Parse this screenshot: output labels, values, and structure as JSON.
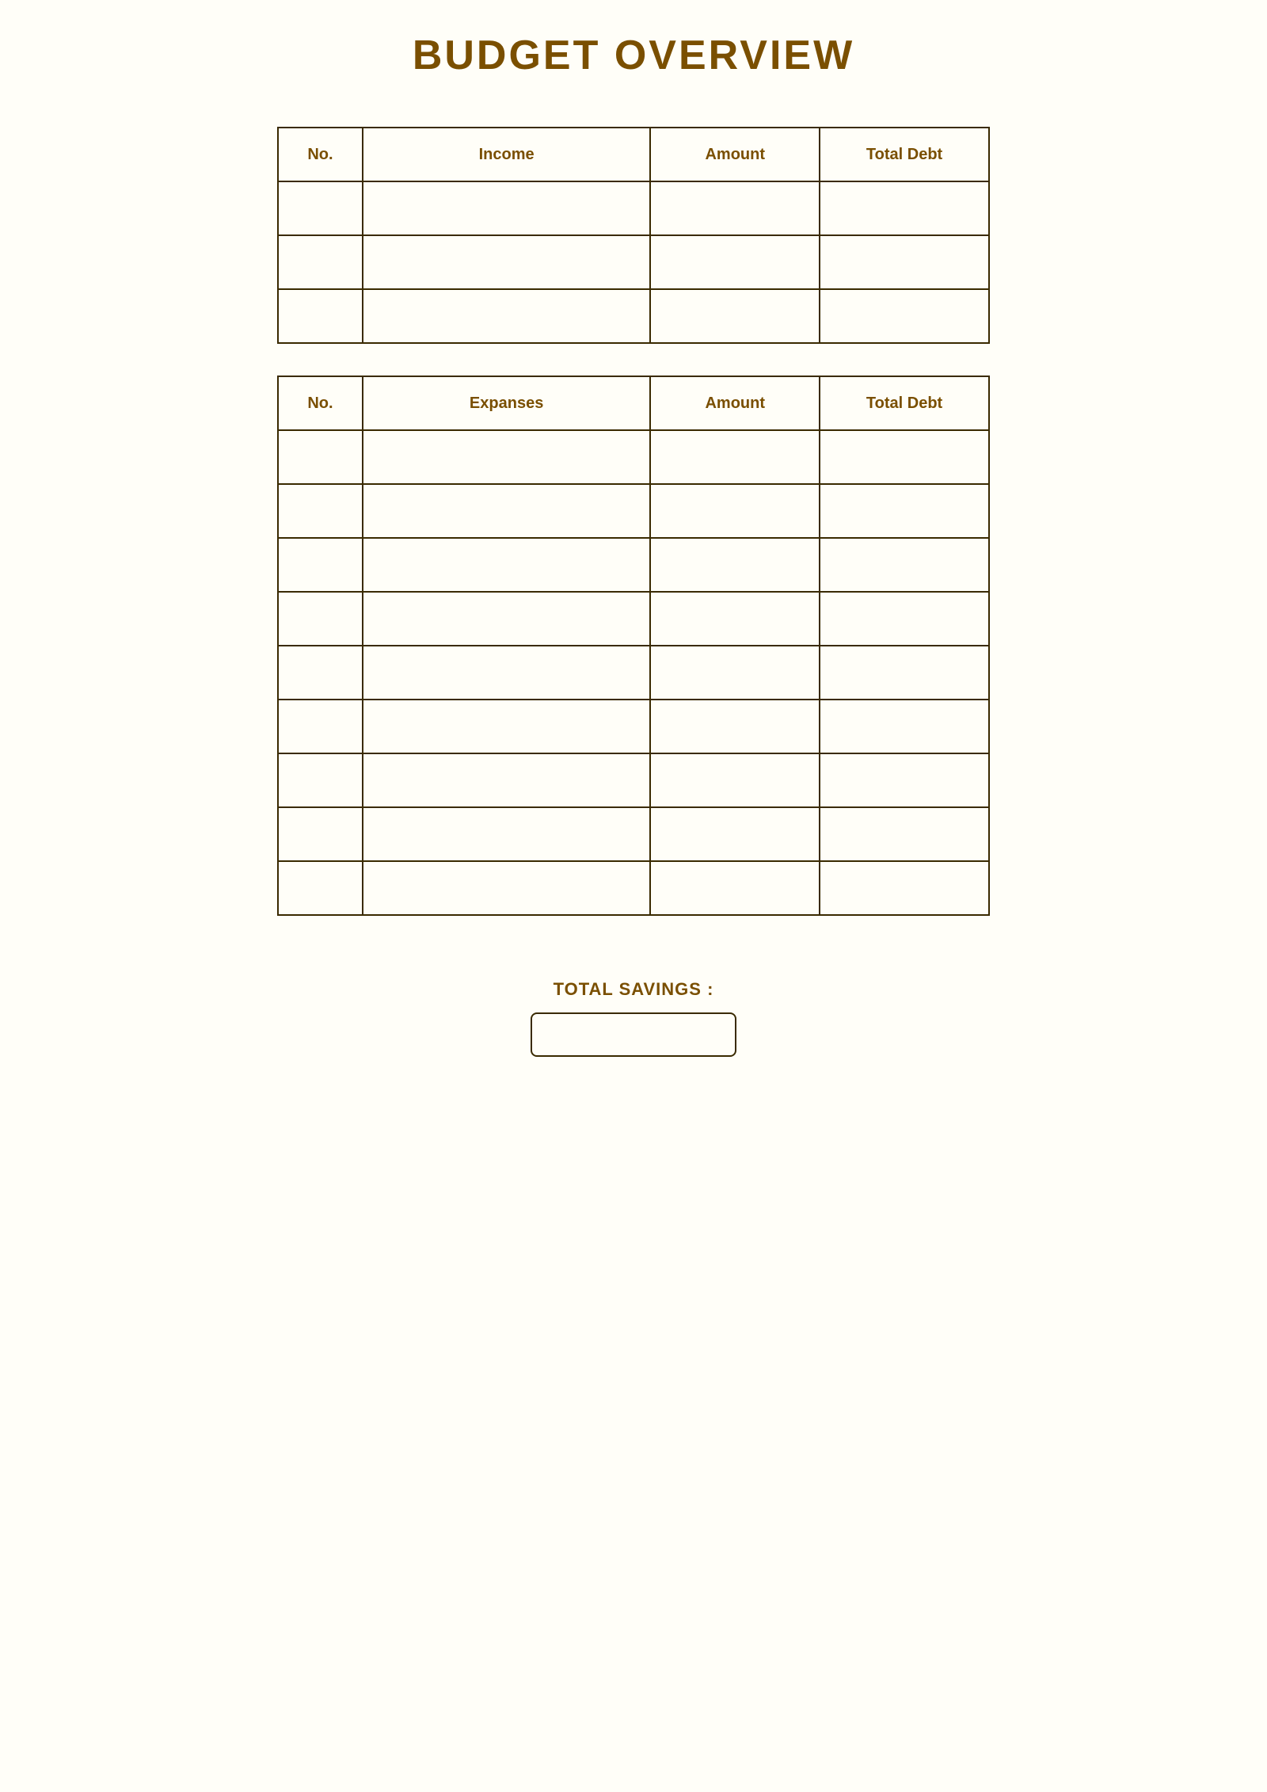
{
  "page": {
    "title": "BUDGET OVERVIEW",
    "income_table": {
      "headers": {
        "no": "No.",
        "description": "Income",
        "amount": "Amount",
        "total_debt": "Total Debt"
      },
      "data_rows": 3
    },
    "expenses_table": {
      "headers": {
        "no": "No.",
        "description": "Expanses",
        "amount": "Amount",
        "total_debt": "Total Debt"
      },
      "data_rows": 9
    },
    "total_savings": {
      "label": "TOTAL SAVINGS :"
    }
  }
}
